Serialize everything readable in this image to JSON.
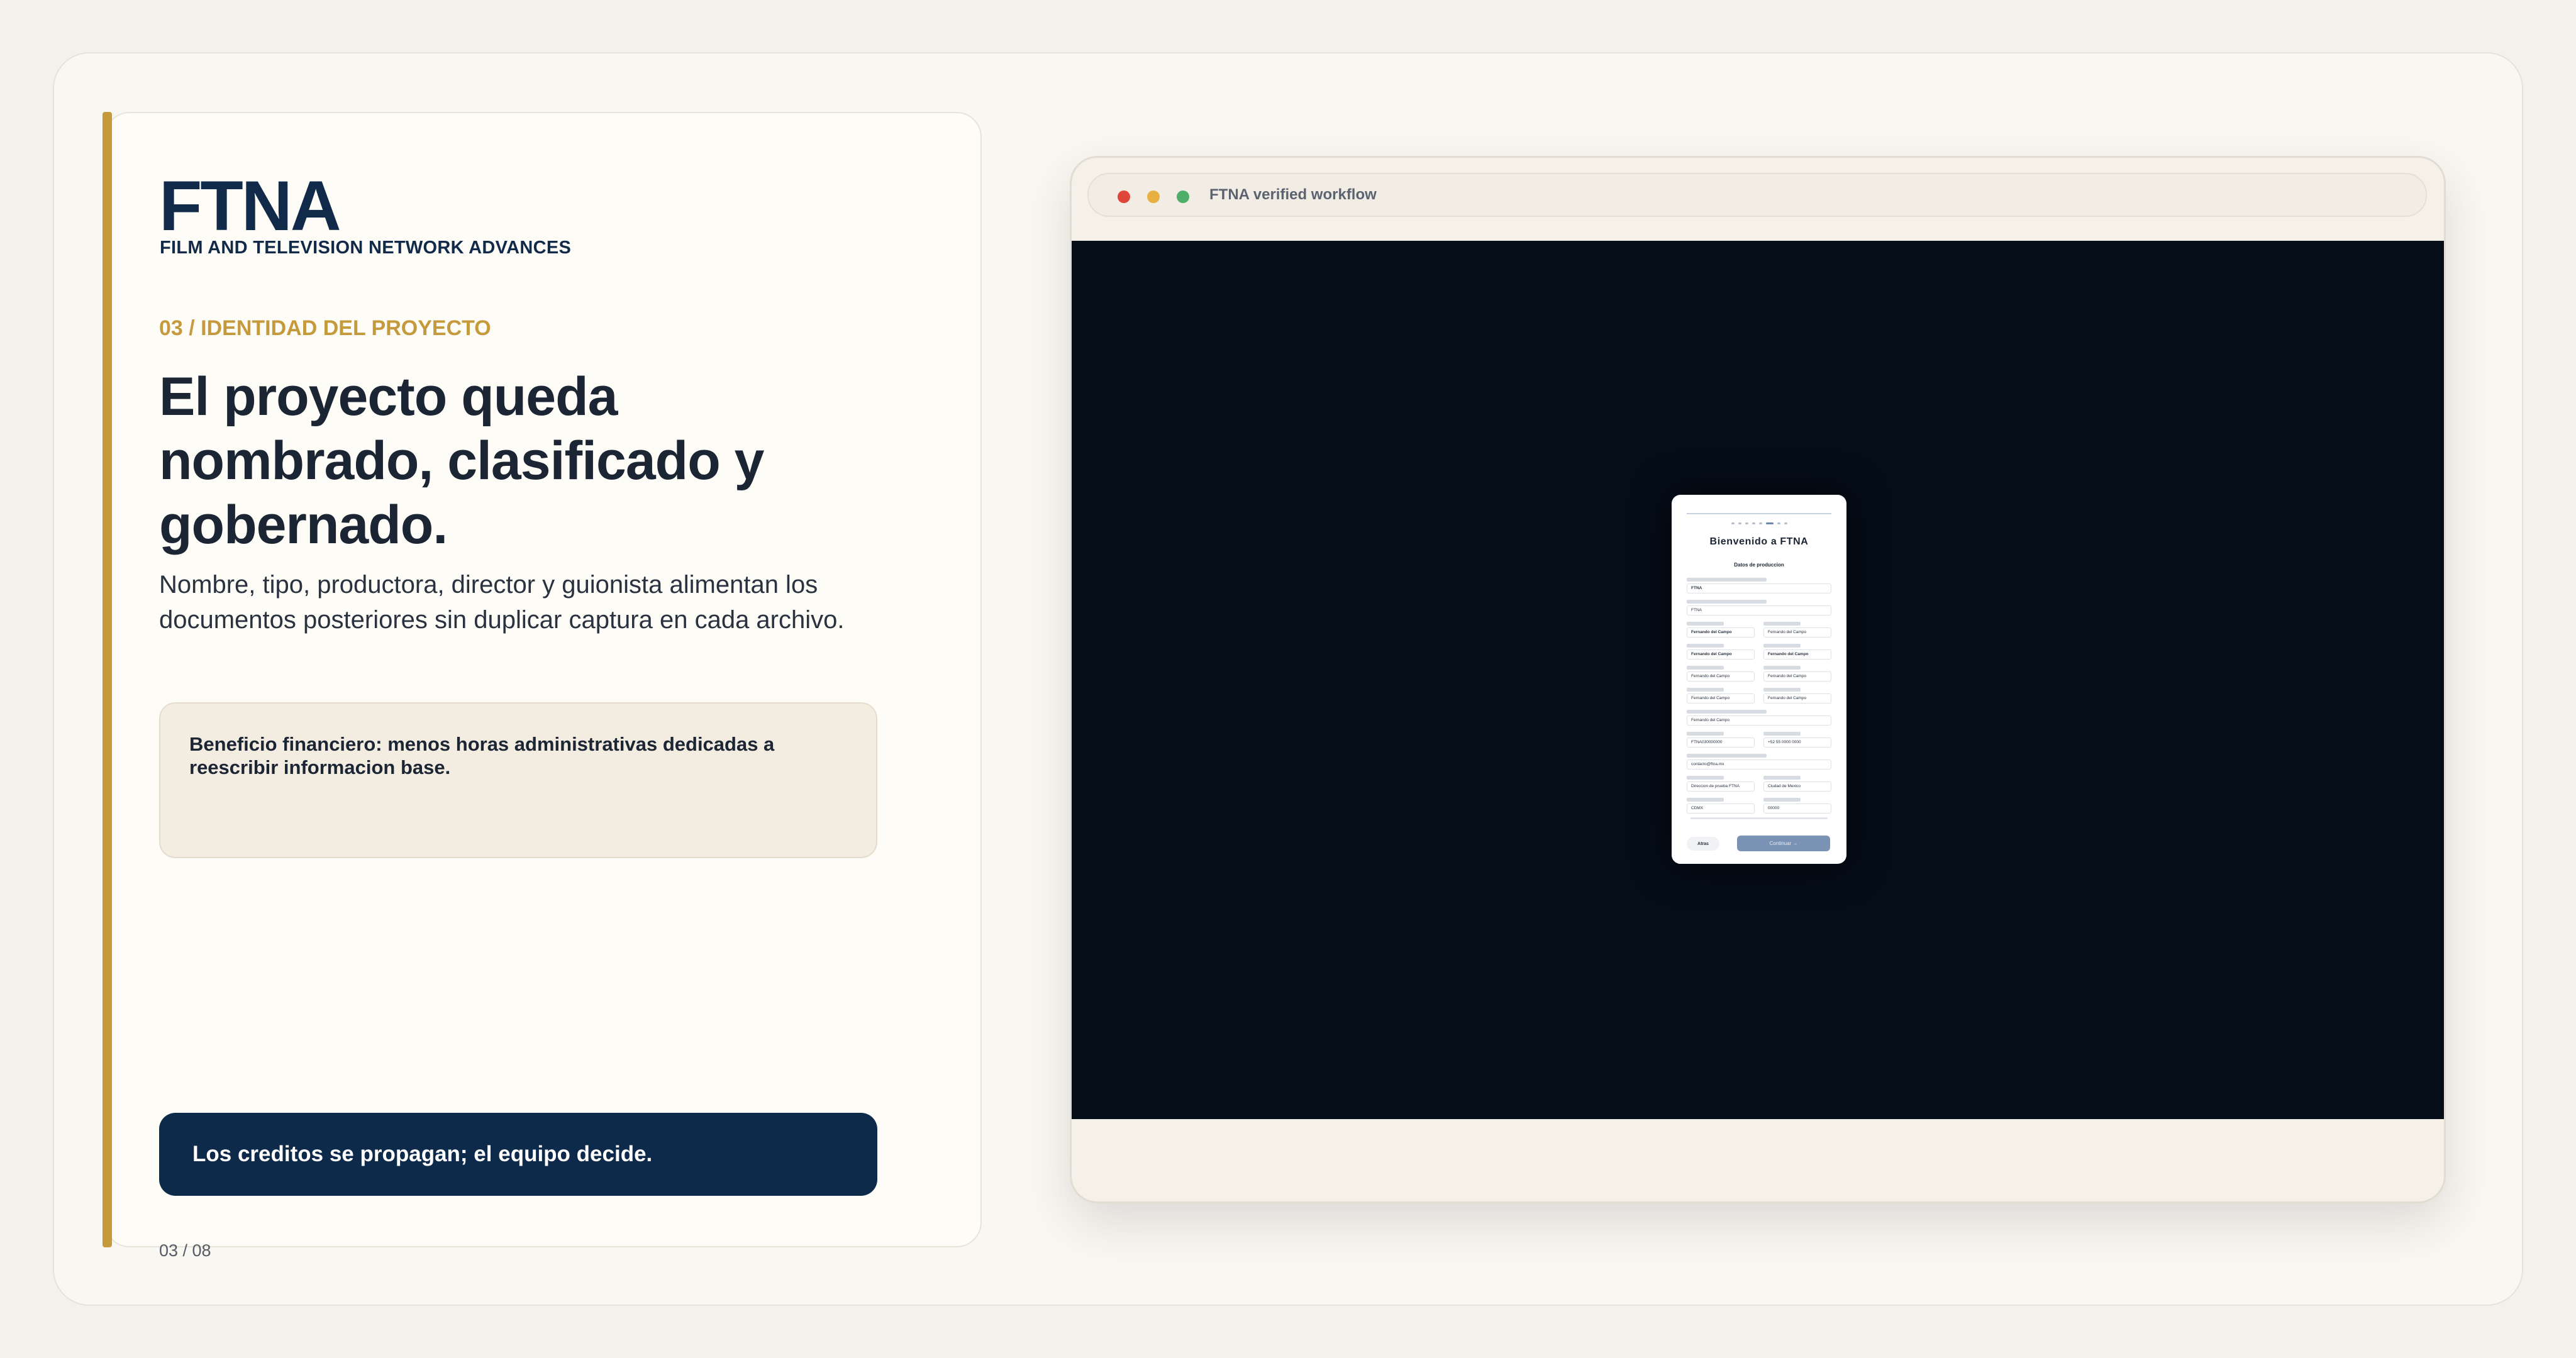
{
  "brand": {
    "name": "FTNA",
    "subtitle": "FILM AND TELEVISION NETWORK ADVANCES"
  },
  "section_label": "03 / IDENTIDAD DEL PROYECTO",
  "headline": "El proyecto queda nombrado, clasificado y gobernado.",
  "lead": "Nombre, tipo, productora, director y guionista alimentan los documentos posteriores sin duplicar captura en cada archivo.",
  "benefit": "Beneficio financiero: menos horas administrativas dedicadas a reescribir informacion base.",
  "credits_button": "Los creditos se propagan; el equipo decide.",
  "page_number": "03 / 08",
  "colors": {
    "accent": "#c49a3c",
    "navy": "#0e2a4a",
    "viewport": "#050d19"
  },
  "browser": {
    "title": "FTNA verified workflow",
    "controls": [
      "close-dot-red",
      "minimize-dot-yellow",
      "maximize-dot-green"
    ]
  },
  "form": {
    "title": "Bienvenido a FTNA",
    "subtitle": "Datos de produccion",
    "fields": [
      {
        "value": "FTNA"
      },
      {
        "value": "FTNA"
      },
      {
        "value": "Fernando del Campo"
      },
      {
        "value": "Fernando del Campo"
      },
      {
        "value": "Fernando del Campo"
      },
      {
        "value": "Fernando del Campo"
      },
      {
        "value": "Fernando del Campo"
      },
      {
        "value": "Fernando del Campo"
      },
      {
        "value": "Fernando del Campo"
      },
      {
        "value": "Fernando del Campo"
      },
      {
        "value": "Fernando del Campo"
      },
      {
        "value": "FTNA030000000"
      },
      {
        "value": "+52 55 0000 0000"
      },
      {
        "value": "contacto@ftna.mx"
      },
      {
        "value": "Direccion de prueba FTNA"
      },
      {
        "value": "Ciudad de Mexico"
      },
      {
        "value": "CDMX"
      },
      {
        "value": "00000"
      }
    ],
    "back_label": "Atras",
    "continue_label": "Continuar →"
  }
}
